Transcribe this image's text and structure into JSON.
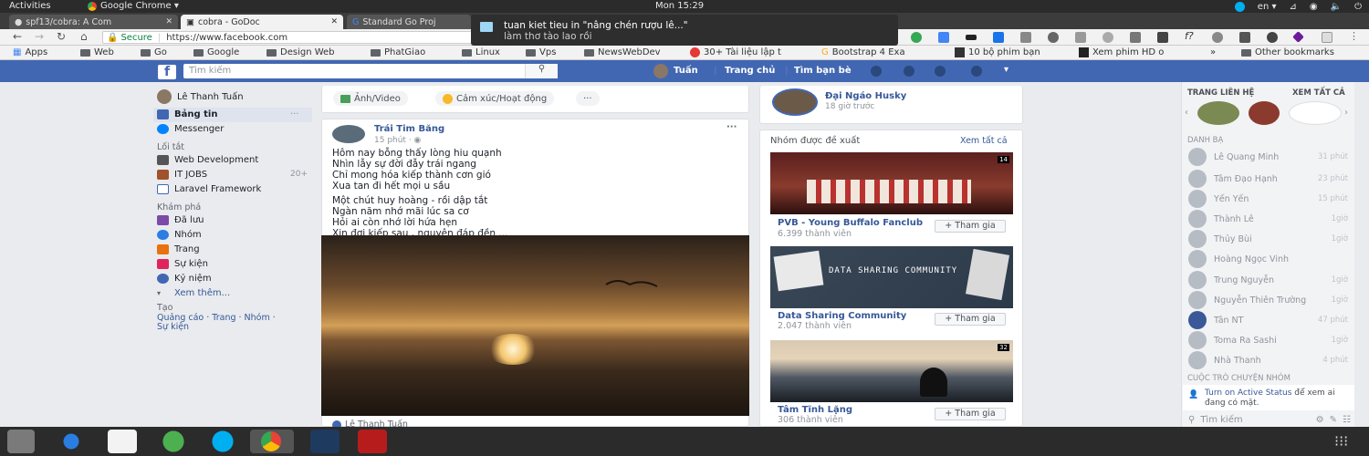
{
  "system": {
    "activities": "Activities",
    "app_name": "Google Chrome ▾",
    "clock": "Mon 15:29",
    "lang": "en ▾"
  },
  "tabs": [
    {
      "title": "spf13/cobra: A Com"
    },
    {
      "title": "cobra - GoDoc"
    },
    {
      "title": "Standard Go Proj"
    }
  ],
  "addressbar": {
    "secure": "Secure",
    "url": "https://www.facebook.com"
  },
  "bookmarks": [
    "Apps",
    "Web",
    "Go",
    "Google",
    "Design Web",
    "PhatGiao",
    "Linux",
    "Vps",
    "NewsWebDev",
    "30+ Tài liệu lập t",
    "Bootstrap 4 Exa",
    "10 bộ phim bạn",
    "Xem phim HD o",
    "»",
    "Other bookmarks"
  ],
  "notification": {
    "title": "tuan kiet tieu in \"nâng chén rượu lê...\"",
    "body": "làm thơ tào lao rồi"
  },
  "facebook": {
    "search_placeholder": "Tìm kiếm",
    "nav": {
      "user": "Tuấn",
      "home": "Trang chủ",
      "find_friends": "Tìm bạn bè"
    }
  },
  "left": {
    "profile": "Lê Thanh Tuấn",
    "news_feed": "Bảng tin",
    "messenger": "Messenger",
    "shortcuts_title": "Lối tắt",
    "shortcuts": [
      "Web Development",
      "IT JOBS",
      "Laravel Framework"
    ],
    "shortcut_badge": "20+",
    "explore_title": "Khám phá",
    "explore": [
      "Đã lưu",
      "Nhóm",
      "Trang",
      "Sự kiện",
      "Kỷ niệm"
    ],
    "see_more": "Xem thêm...",
    "create_title": "Tạo",
    "create_links": "Quảng cáo · Trang · Nhóm ·",
    "create_links2": "Sự kiện"
  },
  "composer": {
    "photo": "Ảnh/Video",
    "feeling": "Cảm xúc/Hoạt động",
    "more": "···"
  },
  "post": {
    "author": "Trái Tim Băng",
    "time": "15 phút · ",
    "lines": [
      "Hôm nay bỗng thấy lòng hiu quạnh",
      "Nhìn lẫy sự đời đẫy trái ngang",
      "Chỉ mong hóa kiếp thành cơn gió",
      "Xua tan đi hết mọi u sầu",
      "Một chút huy hoàng - rồi dập tắt",
      "Ngàn năm nhớ mãi lúc sa cơ",
      "Hỏi ai còn nhớ lời hứa hẹn",
      "Xin đợi kiếp sau , nguyện đáp đền ..."
    ],
    "reaction": "Lê Thanh Tuấn"
  },
  "story": {
    "name": "Đại Ngáo Husky",
    "time": "18 giờ trước"
  },
  "groups": {
    "title": "Nhóm được đề xuất",
    "see_all": "Xem tất cả",
    "join": "+ Tham gia",
    "items": [
      {
        "name": "PVB - Young Buffalo Fanclub",
        "members": "6.399 thành viên",
        "banner": "",
        "badge": "14"
      },
      {
        "name": "Data Sharing Community",
        "members": "2.047 thành viên",
        "banner": "DATA SHARING COMMUNITY",
        "badge": ""
      },
      {
        "name": "Tâm Tĩnh Lặng",
        "members": "306 thành viên",
        "banner": "",
        "badge": "32"
      }
    ]
  },
  "chat": {
    "contacts_title": "TRANG LIÊN HỆ",
    "see_all": "XEM TẤT CẢ",
    "list_title": "DANH BẠ",
    "contacts": [
      {
        "name": "Lê Quang Minh",
        "time": "31 phút"
      },
      {
        "name": "Tâm Đạo Hạnh",
        "time": "23 phút"
      },
      {
        "name": "Yến Yến",
        "time": "15 phút"
      },
      {
        "name": "Thành Lê",
        "time": "1giờ"
      },
      {
        "name": "Thủy Bùi",
        "time": "1giờ"
      },
      {
        "name": "Hoàng Ngọc Vinh",
        "time": ""
      },
      {
        "name": "Trung Nguyễn",
        "time": "1giờ"
      },
      {
        "name": "Nguyễn Thiên Trường",
        "time": "1giờ"
      },
      {
        "name": "Tân NT",
        "time": "47 phút"
      },
      {
        "name": "Toma Ra Sashi",
        "time": "1giờ"
      },
      {
        "name": "Nhà Thanh",
        "time": "4 phút"
      }
    ],
    "group_title": "CUỘC TRÒ CHUYỆN NHÓM",
    "active_status_link": "Turn on Active Status",
    "active_status_text": "để xem ai đang có mặt.",
    "search": "Tìm kiếm"
  }
}
